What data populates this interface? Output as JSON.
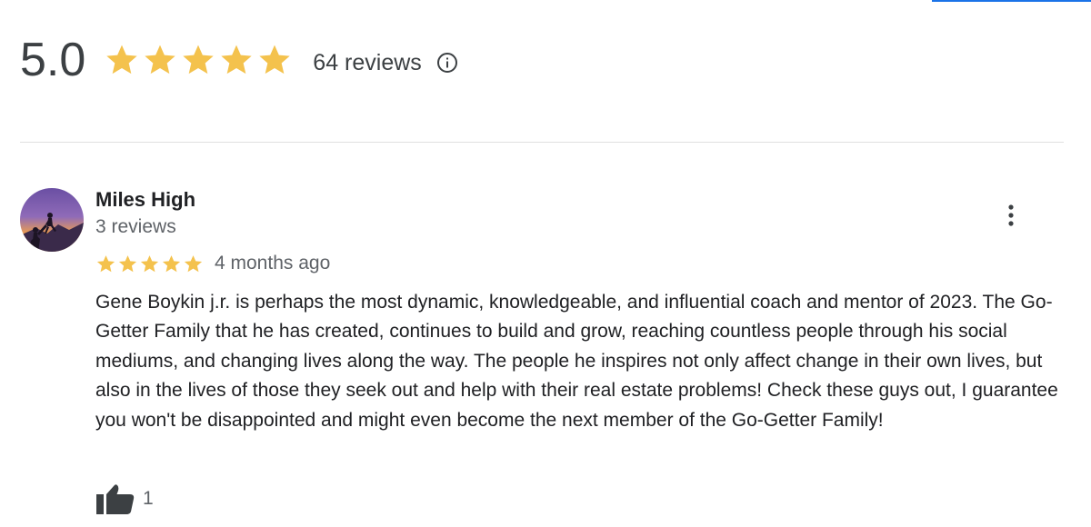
{
  "summary": {
    "average_rating": "5.0",
    "star_rating": 5,
    "star_max": 5,
    "review_count_label": "64 reviews",
    "info_icon": "info-circle-icon"
  },
  "colors": {
    "star": "#f4c24d",
    "text_primary": "#202124",
    "text_secondary": "#5f6368",
    "divider": "#e0e0e0",
    "link_accent": "#1a73e8"
  },
  "review": {
    "reviewer_name": "Miles High",
    "reviewer_meta": "3 reviews",
    "rating": 5,
    "date": "4 months ago",
    "text": "Gene Boykin j.r. is perhaps the most dynamic, knowledgeable, and influential coach and mentor of 2023. The Go-Getter Family that he has created, continues to build and grow, reaching countless people through his social mediums, and changing lives along the way. The people he inspires not only affect change in their own lives, but also in the lives of those they seek out and help with their real estate problems! Check these guys out, I guarantee you won't be disappointed and might even become the next member of the Go-Getter Family!",
    "likes": "1",
    "avatar_icon": "avatar-silhouette-climbers",
    "more_icon": "more-vertical-icon",
    "like_icon": "thumbs-up-icon"
  }
}
